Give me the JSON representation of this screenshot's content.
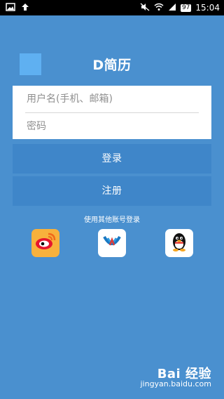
{
  "status_bar": {
    "battery": "97",
    "time": "15:04"
  },
  "header": {
    "title": "D简历"
  },
  "form": {
    "username_placeholder": "用户名(手机、邮箱)",
    "password_placeholder": "密码"
  },
  "buttons": {
    "login": "登录",
    "register": "注册"
  },
  "other_login": {
    "label": "使用其他账号登录",
    "providers": [
      "weibo-icon",
      "wb-social-icon",
      "qq-icon"
    ]
  },
  "watermark": {
    "brand": "Bai 经验",
    "url": "jingyan.baidu.com"
  },
  "colors": {
    "background": "#4a90cf",
    "button": "#3f86c9",
    "app_square": "#5fb0f1"
  }
}
